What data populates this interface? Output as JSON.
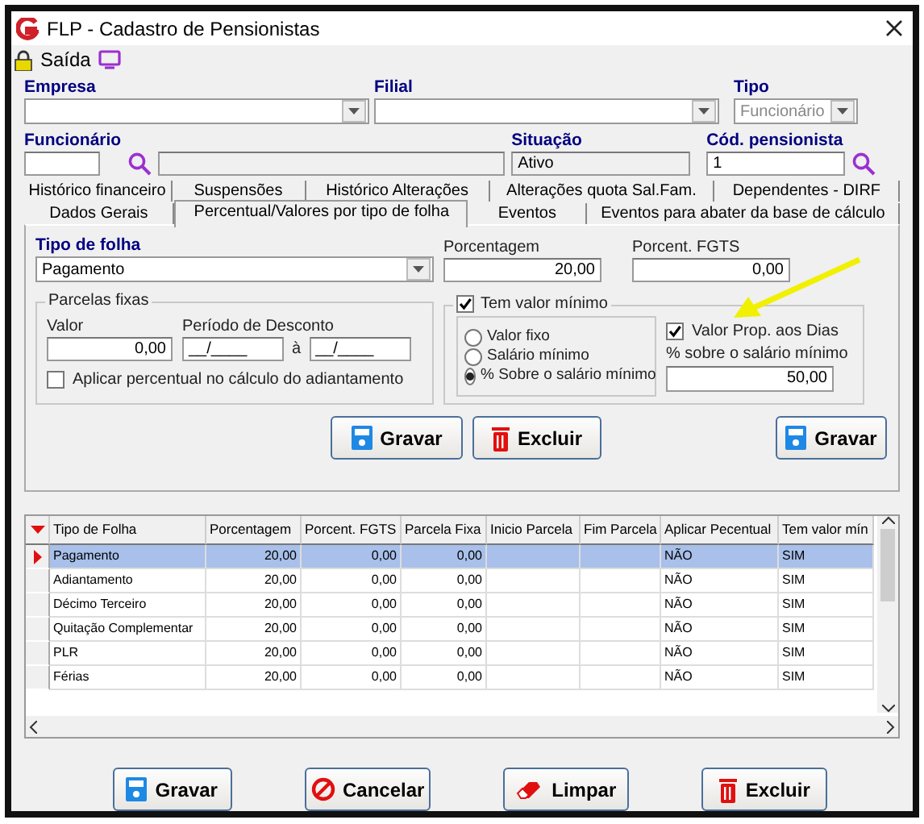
{
  "window": {
    "title": "FLP - Cadastro de Pensionistas"
  },
  "toolbar": {
    "exit_label": "Saída"
  },
  "empresa": {
    "label": "Empresa"
  },
  "filial": {
    "label": "Filial"
  },
  "tipo": {
    "label": "Tipo",
    "value": "Funcionário",
    "disabled": true
  },
  "funcionario": {
    "label": "Funcionário"
  },
  "situacao": {
    "label": "Situação",
    "value": "Ativo"
  },
  "cod_pensionista": {
    "label": "Cód. pensionista",
    "value": "1"
  },
  "tabs_row_1": [
    {
      "label": "Histórico financeiro",
      "selected": false
    },
    {
      "label": "Suspensões",
      "selected": false
    },
    {
      "label": "Histórico Alterações",
      "selected": false
    },
    {
      "label": "Alterações quota Sal.Fam.",
      "selected": false
    },
    {
      "label": "Dependentes - DIRF",
      "selected": false
    }
  ],
  "tabs_row_2": [
    {
      "label": "Dados Gerais",
      "selected": false
    },
    {
      "label": "Percentual/Valores por tipo de folha",
      "selected": true
    },
    {
      "label": "Eventos",
      "selected": false
    },
    {
      "label": "Eventos para abater da base de cálculo",
      "selected": false
    }
  ],
  "tipo_de_folha": {
    "label": "Tipo de folha",
    "value": "Pagamento"
  },
  "porcentagem": {
    "label": "Porcentagem",
    "value": "20,00"
  },
  "porcent_fgts": {
    "label": "Porcent. FGTS",
    "value": "0,00"
  },
  "parcelas_fixas": {
    "title": "Parcelas fixas",
    "valor_label": "Valor",
    "valor": "0,00",
    "periodo_label": "Período de Desconto",
    "periodo_inicio": "__/____",
    "separator": "à",
    "periodo_fim": "__/____",
    "aplicar": {
      "label": "Aplicar percentual no cálculo do adiantamento",
      "checked": false
    }
  },
  "valor_minimo": {
    "label": "Tem valor mínimo",
    "checked": true,
    "options": [
      {
        "label": "Valor fixo",
        "selected": false
      },
      {
        "label": "Salário mínimo",
        "selected": false
      },
      {
        "label": "% Sobre o salário mínimo",
        "selected": true
      }
    ],
    "prop_dias": {
      "label": "Valor Prop. aos Dias",
      "checked": true
    },
    "percent_label": "% sobre o salário mínimo",
    "percent_value": "50,00",
    "save_button": {
      "kind": "save",
      "label": "Gravar"
    }
  },
  "panel_buttons": [
    {
      "kind": "save",
      "label": "Gravar"
    },
    {
      "kind": "delete",
      "label": "Excluir"
    }
  ],
  "table": {
    "columns": [
      "Tipo de Folha",
      "Porcentagem",
      "Porcent. FGTS",
      "Parcela Fixa",
      "Inicio Parcela",
      "Fim Parcela",
      "Aplicar Pecentual",
      "Tem valor mín"
    ],
    "rows": [
      {
        "selected": true,
        "cells": [
          "Pagamento",
          "20,00",
          "0,00",
          "0,00",
          "",
          "",
          "NÃO",
          "SIM"
        ]
      },
      {
        "selected": false,
        "cells": [
          "Adiantamento",
          "20,00",
          "0,00",
          "0,00",
          "",
          "",
          "NÃO",
          "SIM"
        ]
      },
      {
        "selected": false,
        "cells": [
          "Décimo Terceiro",
          "20,00",
          "0,00",
          "0,00",
          "",
          "",
          "NÃO",
          "SIM"
        ]
      },
      {
        "selected": false,
        "cells": [
          "Quitação Complementar",
          "20,00",
          "0,00",
          "0,00",
          "",
          "",
          "NÃO",
          "SIM"
        ]
      },
      {
        "selected": false,
        "cells": [
          "PLR",
          "20,00",
          "0,00",
          "0,00",
          "",
          "",
          "NÃO",
          "SIM"
        ]
      },
      {
        "selected": false,
        "cells": [
          "Férias",
          "20,00",
          "0,00",
          "0,00",
          "",
          "",
          "NÃO",
          "SIM"
        ]
      }
    ]
  },
  "buttons": [
    {
      "kind": "save",
      "label": "Gravar"
    },
    {
      "kind": "cancel",
      "label": "Cancelar"
    },
    {
      "kind": "clear",
      "label": "Limpar"
    },
    {
      "kind": "delete",
      "label": "Excluir"
    }
  ]
}
